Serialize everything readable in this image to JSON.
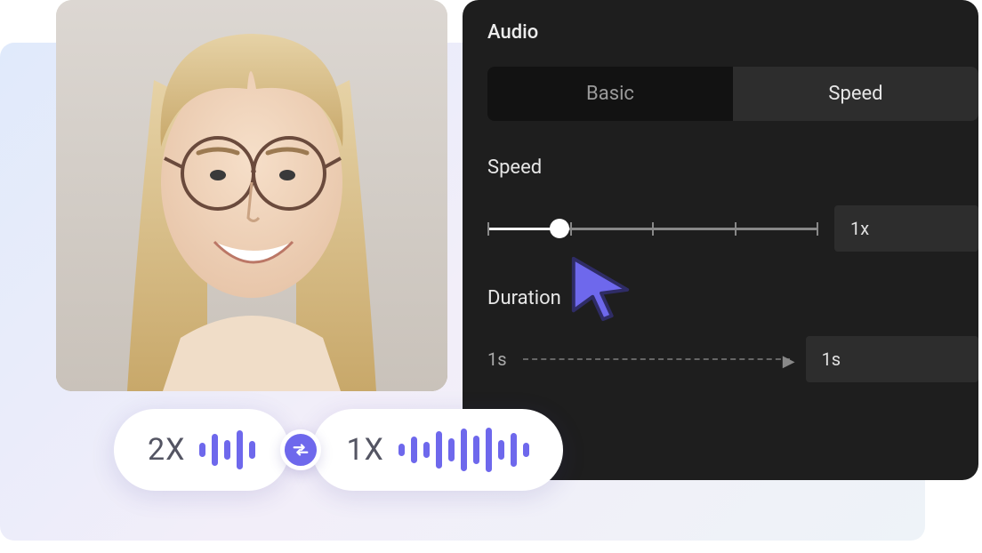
{
  "panel": {
    "title": "Audio",
    "tabs": {
      "basic": "Basic",
      "speed": "Speed"
    },
    "speed": {
      "label": "Speed",
      "value": "1x"
    },
    "duration": {
      "label": "Duration",
      "start": "1s",
      "end": "1s"
    }
  },
  "pills": {
    "left": "2X",
    "right": "1X"
  }
}
